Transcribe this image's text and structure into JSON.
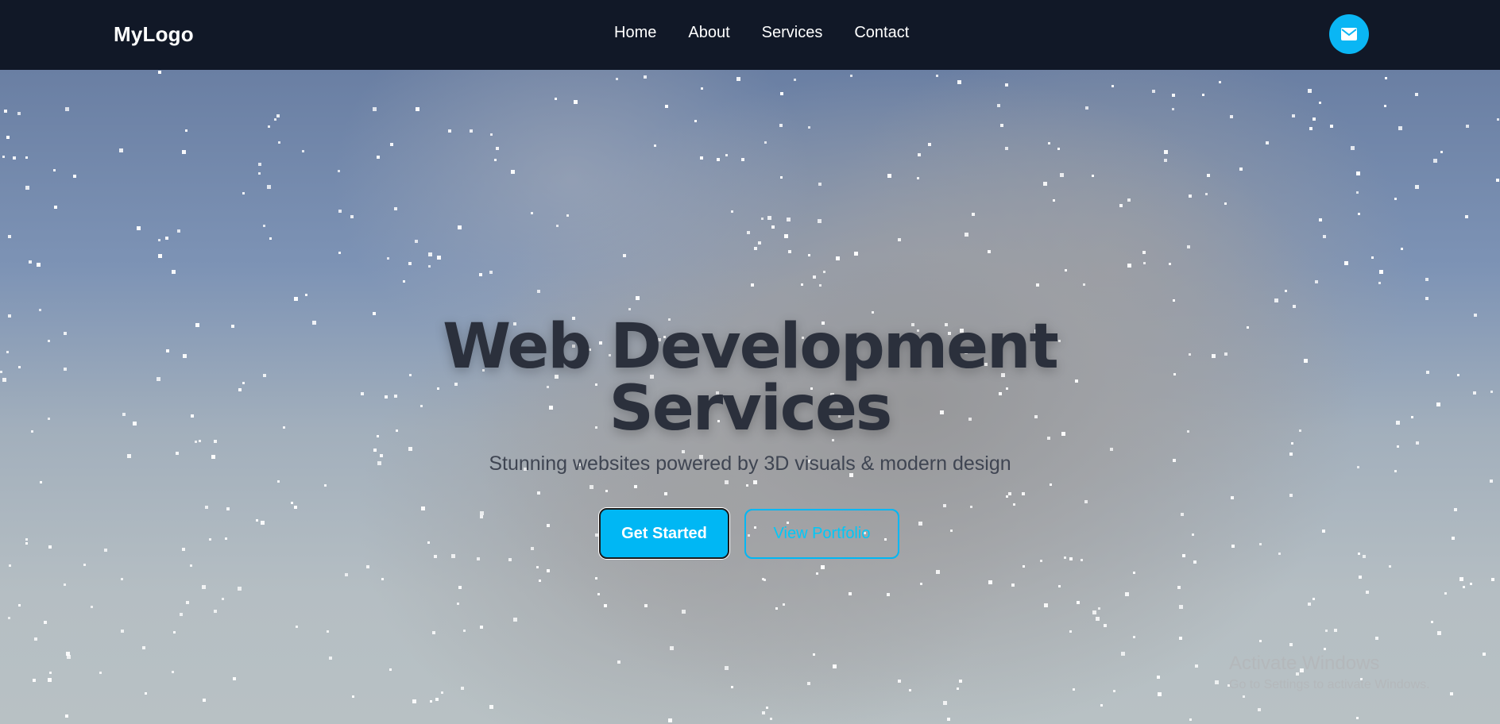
{
  "navbar": {
    "logo": "MyLogo",
    "links": [
      "Home",
      "About",
      "Services",
      "Contact"
    ],
    "mail_icon": "envelope-icon"
  },
  "hero": {
    "title_line1": "Web Development",
    "title_line2": "Services",
    "subtitle": "Stunning websites powered by 3D visuals & modern design",
    "primary_button": "Get Started",
    "secondary_button": "View Portfolio"
  },
  "watermark": {
    "line1": "Activate Windows",
    "line2": "Go to Settings to activate Windows."
  },
  "colors": {
    "navbar_bg": "#111827",
    "accent": "#00b7f4",
    "title_text": "#2b303c"
  }
}
